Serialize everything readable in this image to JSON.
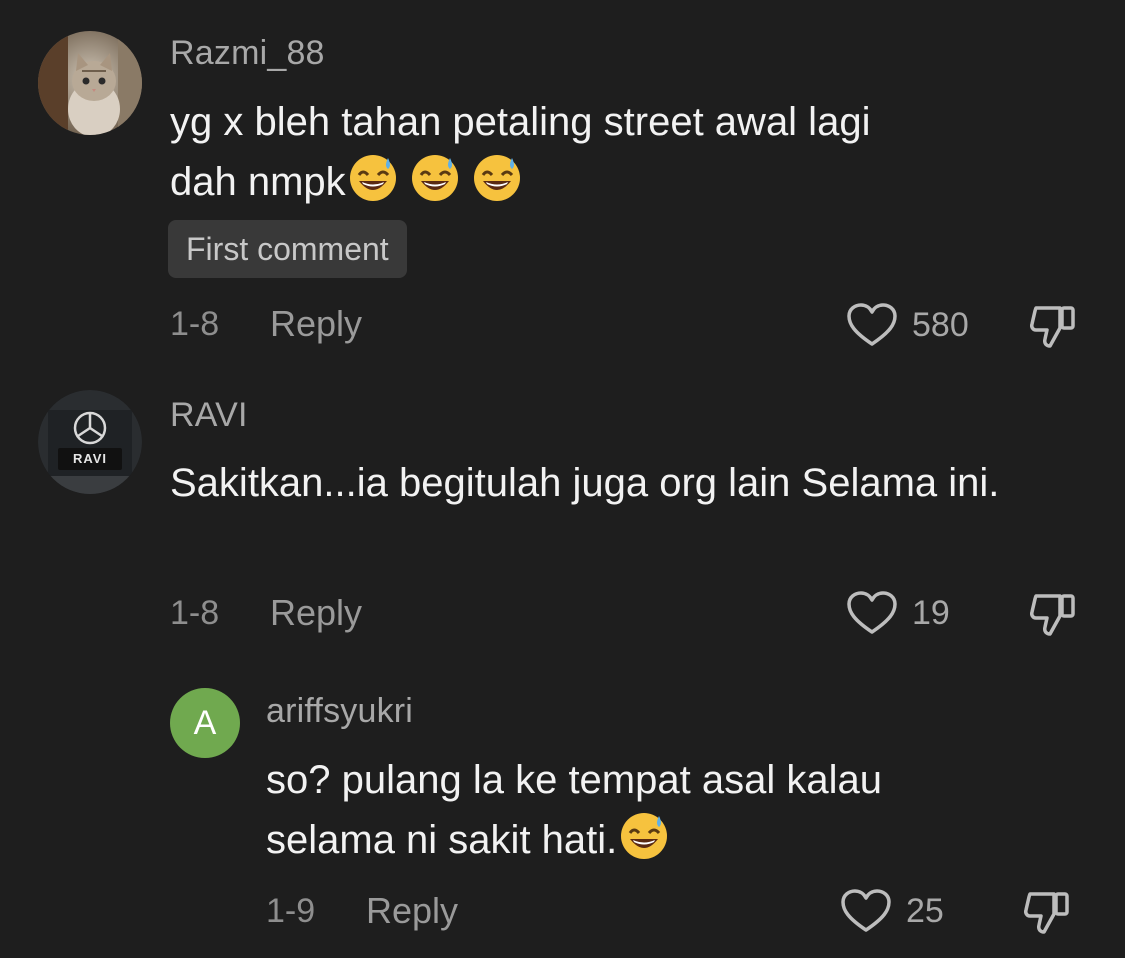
{
  "comments": [
    {
      "username": "Razmi_88",
      "text": "yg x bleh tahan petaling street awal lagi dah nmpk",
      "emojis": [
        "sweat-smile",
        "sweat-smile",
        "sweat-smile"
      ],
      "badge": "First comment",
      "date": "1-8",
      "reply_label": "Reply",
      "likes": "580"
    },
    {
      "username": "RAVI",
      "avatar_plate_text": "RAVI",
      "text": "Sakitkan...ia begitulah juga org lain Selama ini.",
      "date": "1-8",
      "reply_label": "Reply",
      "likes": "19"
    },
    {
      "username": "ariffsyukri",
      "avatar_letter": "A",
      "text": "so? pulang la ke tempat asal kalau selama ni sakit hati.",
      "emojis": [
        "sweat-smile"
      ],
      "date": "1-9",
      "reply_label": "Reply",
      "likes": "25",
      "is_reply": true
    }
  ],
  "colors": {
    "background": "#1e1e1e",
    "username": "#a8a8a8",
    "text": "#f2f2f2",
    "letter_avatar": "#70a94f"
  },
  "icons": [
    "heart-icon",
    "thumbs-down-icon",
    "sweat-smile-emoji"
  ]
}
